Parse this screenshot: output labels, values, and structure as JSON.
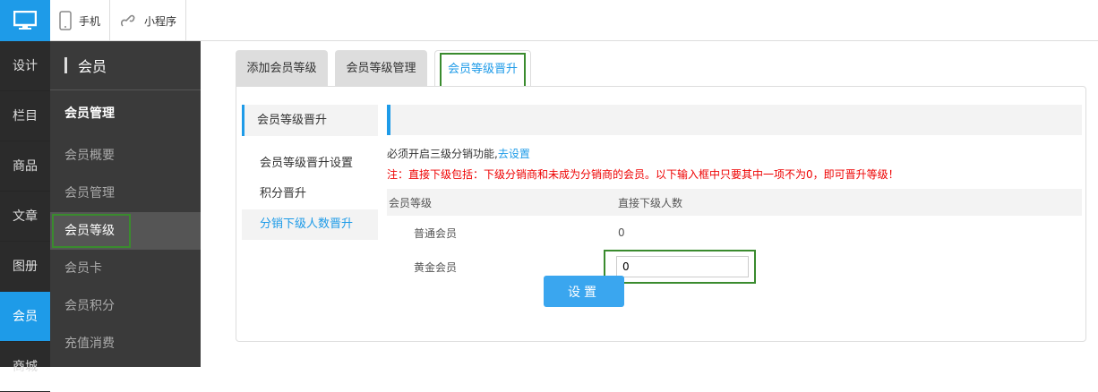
{
  "topbar": {
    "items": [
      {
        "label": "手机",
        "icon": "phone-icon"
      },
      {
        "label": "小程序",
        "icon": "mini-program-icon"
      }
    ]
  },
  "nav1": [
    "设计",
    "栏目",
    "商品",
    "文章",
    "图册",
    "会员",
    "商城"
  ],
  "nav2": {
    "title": "会员",
    "group": "会员管理",
    "links": [
      "会员概要",
      "会员管理",
      "会员等级",
      "会员卡",
      "会员积分",
      "充值消费"
    ]
  },
  "tabs": [
    "添加会员等级",
    "会员等级管理",
    "会员等级晋升"
  ],
  "sidemenu": {
    "title": "会员等级晋升",
    "items": [
      "会员等级晋升设置",
      "积分晋升",
      "分销下级人数晋升"
    ]
  },
  "content": {
    "note1_text": "必须开启三级分销功能,",
    "note1_link": "去设置",
    "note2": "注：直接下级包括：下级分销商和未成为分销商的会员。以下输入框中只要其中一项不为0，即可晋升等级！",
    "col1": "会员等级",
    "col2": "直接下级人数",
    "rows": [
      {
        "level": "普通会员",
        "value": "0"
      },
      {
        "level": "黄金会员",
        "value": "0"
      }
    ],
    "submit": "设置"
  },
  "colors": {
    "accent": "#1e9be8",
    "highlight": "#3a8b2e",
    "warning": "#e00000"
  }
}
